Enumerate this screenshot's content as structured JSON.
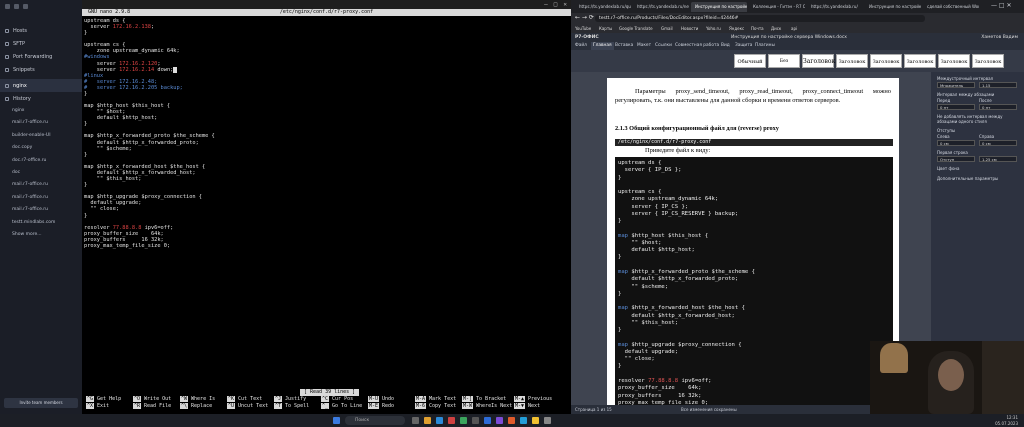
{
  "sidebar": {
    "nav": [
      {
        "label": "Hosts",
        "icon": "hosts-icon"
      },
      {
        "label": "SFTP",
        "icon": "sftp-icon"
      },
      {
        "label": "Port Forwarding",
        "icon": "port-forwarding-icon"
      },
      {
        "label": "Snippets",
        "icon": "snippets-icon"
      }
    ],
    "open_tab": "nginx",
    "history_label": "History",
    "hosts": [
      "nginx",
      "mail.r7-office.ru",
      "builder-enable-UI",
      "doc.copy",
      "doc.r7-office.ru",
      "doc",
      "mail.r7-office.ru",
      "mail.r7-office.ru",
      "mail.r7-office.ru",
      "testt.mindlabs.com",
      "Show more..."
    ],
    "upgrade_label": "Invite team members"
  },
  "terminal": {
    "nano_version": "GNU nano 2.9.8",
    "filename": "/etc/nginx/conf.d/r7-proxy.conf",
    "status": "[ Read 39 lines ]",
    "shortcuts": [
      {
        "key": "^G",
        "label": "Get Help"
      },
      {
        "key": "^O",
        "label": "Write Out"
      },
      {
        "key": "^W",
        "label": "Where Is"
      },
      {
        "key": "^K",
        "label": "Cut Text"
      },
      {
        "key": "^J",
        "label": "Justify"
      },
      {
        "key": "^C",
        "label": "Cur Pos"
      },
      {
        "key": "M-U",
        "label": "Undo"
      },
      {
        "key": "M-A",
        "label": "Mark Text"
      },
      {
        "key": "M-]",
        "label": "To Bracket"
      },
      {
        "key": "M-▲",
        "label": "Previous"
      },
      {
        "key": "^X",
        "label": "Exit"
      },
      {
        "key": "^R",
        "label": "Read File"
      },
      {
        "key": "^\\",
        "label": "Replace"
      },
      {
        "key": "^U",
        "label": "Uncut Text"
      },
      {
        "key": "^T",
        "label": "To Spell"
      },
      {
        "key": "^_",
        "label": "Go To Line"
      },
      {
        "key": "M-E",
        "label": "Redo"
      },
      {
        "key": "M-6",
        "label": "Copy Text"
      },
      {
        "key": "M-W",
        "label": "WhereIs Next"
      },
      {
        "key": "M-▼",
        "label": "Next"
      }
    ]
  },
  "browser": {
    "tabs": [
      "https://ts.yandexlab.ru/quest/",
      "https://ts.yandexlab.ru/network/",
      "Инструкция по настройке",
      "Коллекция - Гитэн - R7 Офис",
      "https://ts.yandexlab.ru/",
      "Инструкция по настройке",
      "сделай собственный Workbench"
    ],
    "url": "testt.r7-office.ru/Products/Files/DocEditor.aspx?fileid=42446#",
    "bookmarks": [
      "YouTube",
      "Карты",
      "Google Translate",
      "Gmail",
      "Новости",
      "Yoho.ru",
      "Яндекс",
      "Почта",
      "Диск",
      "api"
    ],
    "doc_title": "Инструкция по настройке сервера Windows.docx",
    "user": "Хаметов Вадим",
    "ribbon_tabs": [
      "Файл",
      "Главная",
      "Вставка",
      "Макет",
      "Ссылки",
      "Совместная работа",
      "Вид",
      "Защита",
      "Плагины"
    ],
    "styles": [
      "Обычный",
      "Без интервала",
      "Заголовок 1",
      "Заголовок 2",
      "Заголовок 3",
      "Заголовок 4",
      "Заголовок 5",
      "Заголовок 6"
    ],
    "app_name": "Р7-ОФИС",
    "status_left": "Страница 1 из 15",
    "status_mid": "Все изменения сохранены",
    "right_panel": {
      "title": "Междустрочный интервал",
      "line_spacing": "Множитель",
      "line_value": "1.15",
      "para_spacing_title": "Интервал между абзацами",
      "before_label": "Перед",
      "after_label": "После",
      "before_value": "0 пт",
      "after_value": "0 пт",
      "no_add": "Не добавлять интервал между абзацами одного стиля",
      "indents_title": "Отступы",
      "left_label": "Слева",
      "right_label": "Справа",
      "indent_value": "0 см",
      "first_line_title": "Первая строка",
      "first_line": "Отступ",
      "first_value": "1.25 см",
      "bg_label": "Цвет фона",
      "advanced": "Дополнительные параметры"
    }
  },
  "document": {
    "para1": "Параметры proxy_send_timeout, proxy_read_timeout, proxy_connect_timeout можно регулировать, т.к. они выставлены для данной сборки и времени ответов серверов.",
    "heading": "2.1.3 Общий конфигурационный файл для (reverse) proxy",
    "path": "/etc/nginx/conf.d/r7-proxy.conf",
    "bring": "Приведите файл к виду:"
  },
  "taskbar": {
    "search_placeholder": "Поиск",
    "time": "12:31",
    "date": "05.07.2023"
  }
}
